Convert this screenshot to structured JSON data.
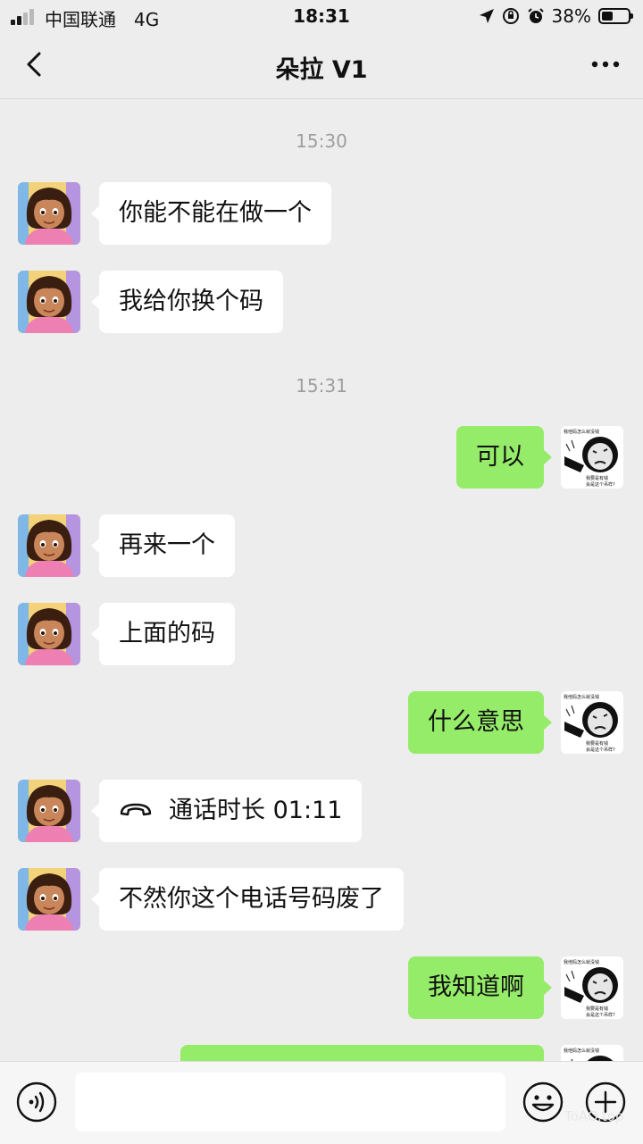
{
  "status_bar": {
    "carrier": "中国联通",
    "network": "4G",
    "time": "18:31",
    "battery": "38%"
  },
  "nav": {
    "title": "朵拉 V1"
  },
  "messages": [
    {
      "timestamp": "15:30"
    },
    {
      "from": "contact",
      "text": "你能不能在做一个"
    },
    {
      "from": "contact",
      "text": "我给你换个码"
    },
    {
      "timestamp": "15:31"
    },
    {
      "from": "me",
      "text": "可以"
    },
    {
      "from": "contact",
      "text": "再来一个"
    },
    {
      "from": "contact",
      "text": "上面的码"
    },
    {
      "from": "me",
      "text": "什么意思"
    },
    {
      "from": "contact",
      "type": "call",
      "icon": "phone-icon",
      "text": "通话时长 01:11"
    },
    {
      "from": "contact",
      "text": "不然你这个电话号码废了"
    },
    {
      "from": "me",
      "text": "我知道啊"
    },
    {
      "from": "me",
      "text": ""
    }
  ],
  "sticker_avatar": {
    "top_text": "我他妈怎么就没钱",
    "bottom_line1": "我要是有钱",
    "bottom_line2": "会是这个吊样?"
  },
  "input_bar": {
    "placeholder": "",
    "watermark": "ToAO.top"
  },
  "colors": {
    "background": "#ededed",
    "outgoing_bubble": "#95ec69",
    "incoming_bubble": "#ffffff",
    "timestamp": "#9e9e9e"
  }
}
